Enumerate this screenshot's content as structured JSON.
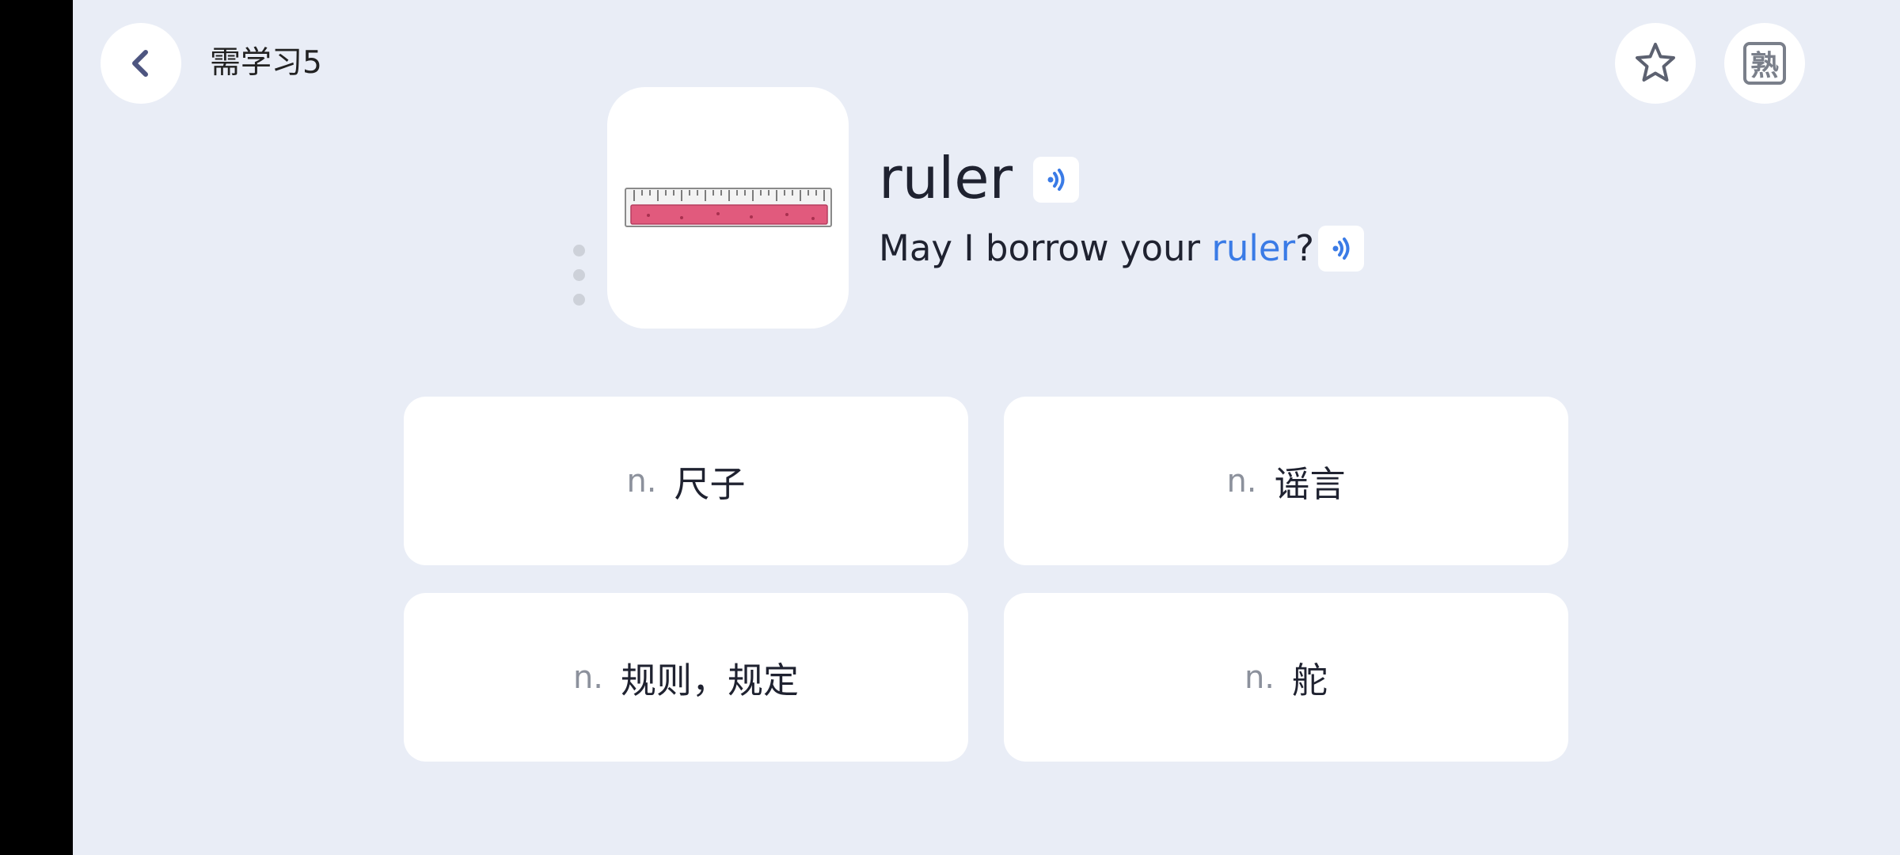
{
  "header": {
    "title": "需学习5",
    "back_icon": "chevron-left-icon",
    "star_icon": "star-outline-icon",
    "familiar_label": "熟"
  },
  "card": {
    "image_icon": "ruler-illustration",
    "word": "ruler",
    "sentence_prefix": "May I borrow your ",
    "sentence_highlight": "ruler",
    "sentence_suffix": "?",
    "sound_icon": "speaker-icon"
  },
  "options": [
    {
      "pos": "n.",
      "meaning": "尺子"
    },
    {
      "pos": "n.",
      "meaning": "谣言"
    },
    {
      "pos": "n.",
      "meaning": "规则，规定"
    },
    {
      "pos": "n.",
      "meaning": "舵"
    }
  ],
  "colors": {
    "background": "#e9edf6",
    "accent": "#3a7be6",
    "ruler_pink": "#e15a7d"
  }
}
